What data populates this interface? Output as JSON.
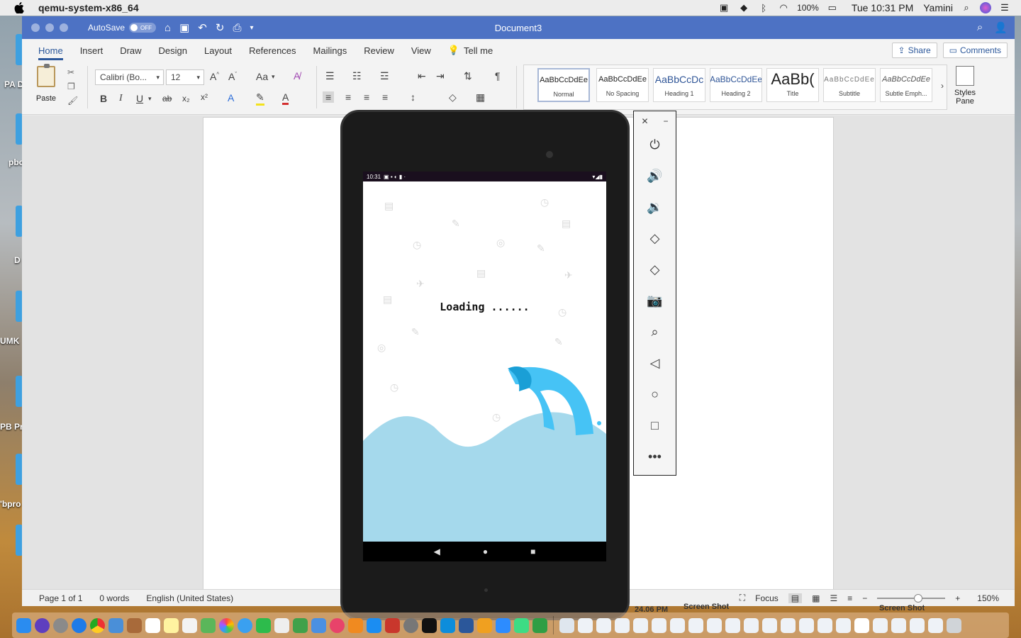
{
  "menubar": {
    "app_name": "qemu-system-x86_64",
    "battery": "100%",
    "clock": "Tue 10:31 PM",
    "user": "Yamini"
  },
  "desktop": {
    "labels": [
      "PA D",
      "pbc",
      "D",
      "UMK",
      "PB Pr",
      "'bpro"
    ],
    "behind_dock": [
      "24.06 PM",
      "Screen Shot",
      "Screen Shot"
    ]
  },
  "word": {
    "autosave_label": "AutoSave",
    "autosave_state": "OFF",
    "document_title": "Document3",
    "tabs": [
      "Home",
      "Insert",
      "Draw",
      "Design",
      "Layout",
      "References",
      "Mailings",
      "Review",
      "View"
    ],
    "tell_me": "Tell me",
    "share": "Share",
    "comments": "Comments",
    "paste": "Paste",
    "font_name": "Calibri (Bo...",
    "font_size": "12",
    "change_case": "Aa",
    "bold": "B",
    "italic": "I",
    "underline": "U",
    "strike": "ab",
    "subscript": "x₂",
    "superscript": "x²",
    "styles": [
      {
        "sample": "AaBbCcDdEe",
        "name": "Normal"
      },
      {
        "sample": "AaBbCcDdEe",
        "name": "No Spacing"
      },
      {
        "sample": "AaBbCcDc",
        "name": "Heading 1"
      },
      {
        "sample": "AaBbCcDdEe",
        "name": "Heading 2"
      },
      {
        "sample": "AaBb(",
        "name": "Title"
      },
      {
        "sample": "AaBbCcDdEe",
        "name": "Subtitle"
      },
      {
        "sample": "AaBbCcDdEe",
        "name": "Subtle Emph..."
      }
    ],
    "styles_pane": "Styles Pane",
    "status": {
      "page": "Page 1 of 1",
      "words": "0 words",
      "language": "English (United States)",
      "focus": "Focus",
      "zoom": "150%"
    }
  },
  "emulator": {
    "android_time": "10:31",
    "loading_text": "Loading ......",
    "toolbar": [
      "power-icon",
      "volume-up-icon",
      "volume-down-icon",
      "rotate-left-icon",
      "rotate-right-icon",
      "camera-icon",
      "zoom-icon",
      "back-icon",
      "home-icon",
      "overview-icon",
      "more-icon"
    ]
  },
  "colors": {
    "word_blue": "#4d72c4",
    "ribbon_accent": "#2b579a",
    "wave_light": "#a5d9ec",
    "wave_blue": "#46c3f5"
  }
}
